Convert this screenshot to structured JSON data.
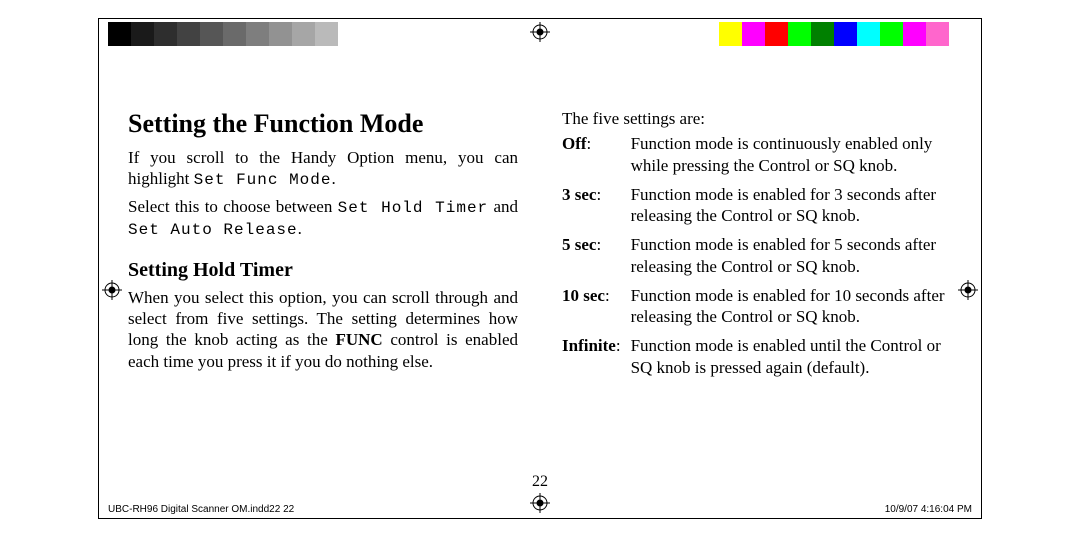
{
  "grayscale": [
    "#000000",
    "#1a1a1a",
    "#2e2e2e",
    "#424242",
    "#565656",
    "#6a6a6a",
    "#7e7e7e",
    "#929292",
    "#a6a6a6",
    "#bababa",
    "#ffffff"
  ],
  "colorbar": [
    "#ffff00",
    "#ff00ff",
    "#ff0000",
    "#00ff00",
    "#008000",
    "#0000ff",
    "#00ffff",
    "#00ff00",
    "#ff00ff",
    "#ff66cc",
    "#ffffff"
  ],
  "left": {
    "h1": "Setting the Function Mode",
    "p1a": "If you scroll to the Handy Option menu, you can highlight ",
    "p1b": "Set Func Mode",
    "p1c": ".",
    "p2a": "Select this to choose between ",
    "p2b": "Set Hold Timer",
    "p2c": " and ",
    "p2d": "Set Auto Release",
    "p2e": ".",
    "h2": "Setting Hold Timer",
    "p3a": "When you select this option, you can scroll through and select from five settings. The setting determines how long the knob acting as the ",
    "p3b": "FUNC",
    "p3c": " control is enabled each time you press it if you do nothing else."
  },
  "right": {
    "intro": "The five settings are:",
    "rows": [
      {
        "key": "Off",
        "desc": "Function mode is continuously enabled only while pressing the Control or SQ knob."
      },
      {
        "key": "3 sec",
        "desc": "Function mode is enabled for 3 seconds after releasing the Control or SQ knob."
      },
      {
        "key": "5 sec",
        "desc": "Function mode is enabled for 5 seconds after releasing the Control or SQ knob."
      },
      {
        "key": "10 sec",
        "desc": "Function mode is enabled for 10 seconds after releasing the Control or SQ knob."
      },
      {
        "key": "Infinite",
        "desc": "Function mode is enabled until the Control or SQ knob is pressed again (default)."
      }
    ]
  },
  "pageNumber": "22",
  "footerLeft": "UBC-RH96 Digital Scanner OM.indd22   22",
  "footerRight": "10/9/07   4:16:04 PM"
}
